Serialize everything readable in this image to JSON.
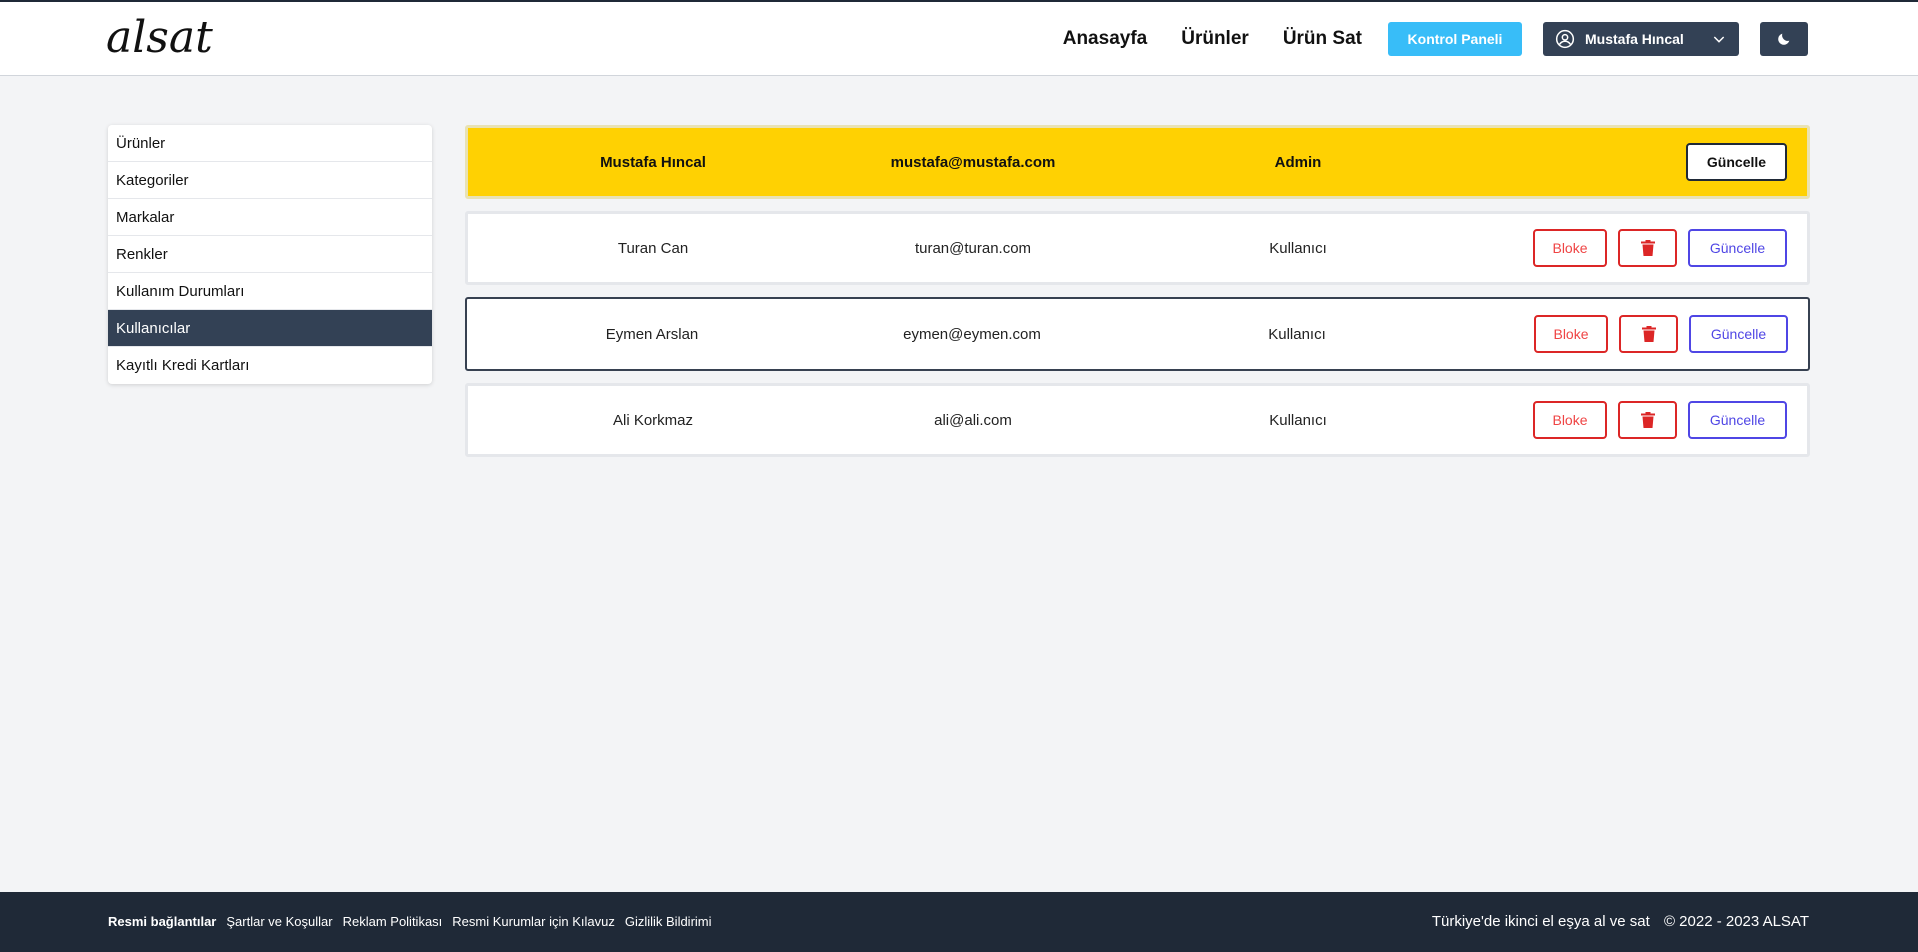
{
  "header": {
    "logo": "alsat",
    "nav": [
      "Anasayfa",
      "Ürünler",
      "Ürün Sat"
    ],
    "panel_button": "Kontrol Paneli",
    "user_name": "Mustafa Hıncal",
    "icons": {
      "user": "user-circle-icon",
      "dropdown": "chevron-down-icon",
      "theme": "moon-icon"
    }
  },
  "sidebar": {
    "items": [
      "Ürünler",
      "Kategoriler",
      "Markalar",
      "Renkler",
      "Kullanım Durumları",
      "Kullanıcılar",
      "Kayıtlı Kredi Kartları"
    ],
    "active_index": 5
  },
  "users": [
    {
      "name": "Mustafa Hıncal",
      "email": "mustafa@mustafa.com",
      "role": "Admin",
      "update_label": "Güncelle"
    },
    {
      "name": "Turan Can",
      "email": "turan@turan.com",
      "role": "Kullanıcı",
      "block_label": "Bloke",
      "update_label": "Güncelle"
    },
    {
      "name": "Eymen Arslan",
      "email": "eymen@eymen.com",
      "role": "Kullanıcı",
      "block_label": "Bloke",
      "update_label": "Güncelle"
    },
    {
      "name": "Ali Korkmaz",
      "email": "ali@ali.com",
      "role": "Kullanıcı",
      "block_label": "Bloke",
      "update_label": "Güncelle"
    }
  ],
  "footer": {
    "links_title": "Resmi bağlantılar",
    "links": [
      "Şartlar ve Koşullar",
      "Reklam Politikası",
      "Resmi Kurumlar için Kılavuz",
      "Gizlilik Bildirimi"
    ],
    "tagline": "Türkiye'de ikinci el eşya al ve sat",
    "copyright": "© 2022 - 2023 ALSAT"
  },
  "colors": {
    "admin_row": "#ffd102",
    "dark": "#334155",
    "panel": "#38bdf8",
    "danger": "#dc2626",
    "primary": "#4f46e5",
    "footer": "#1f2937"
  }
}
